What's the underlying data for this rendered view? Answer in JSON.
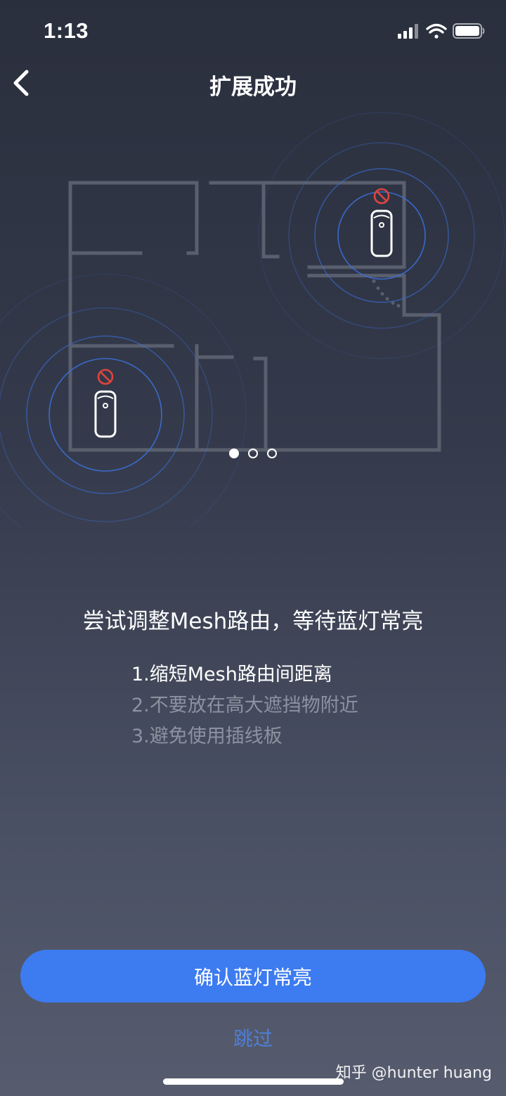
{
  "status_bar": {
    "time": "1:13",
    "icons": [
      "cellular-signal-icon",
      "wifi-icon",
      "battery-icon"
    ]
  },
  "nav": {
    "back_icon": "chevron-left-icon",
    "title": "扩展成功"
  },
  "illustration": {
    "description_icons": [
      "floor-plan",
      "mesh-router-icon",
      "no-signal-icon"
    ],
    "colors": {
      "walls": "#5a5f6d",
      "signal_ring": "#3b6fd8",
      "router": "#ffffff",
      "no_signal": "#e0443e"
    }
  },
  "pager": {
    "total": 3,
    "active": 0
  },
  "headline": "尝试调整Mesh路由，等待蓝灯常亮",
  "tips": [
    {
      "text": "1.缩短Mesh路由间距离",
      "active": true
    },
    {
      "text": "2.不要放在高大遮挡物附近",
      "active": false
    },
    {
      "text": "3.避免使用插线板",
      "active": false
    }
  ],
  "actions": {
    "confirm_label": "确认蓝灯常亮",
    "skip_label": "跳过"
  },
  "watermark": "知乎 @hunter huang",
  "colors": {
    "accent": "#3d7bf0",
    "skip_text": "#4f7fd8",
    "inactive_text": "#8d92a0"
  }
}
